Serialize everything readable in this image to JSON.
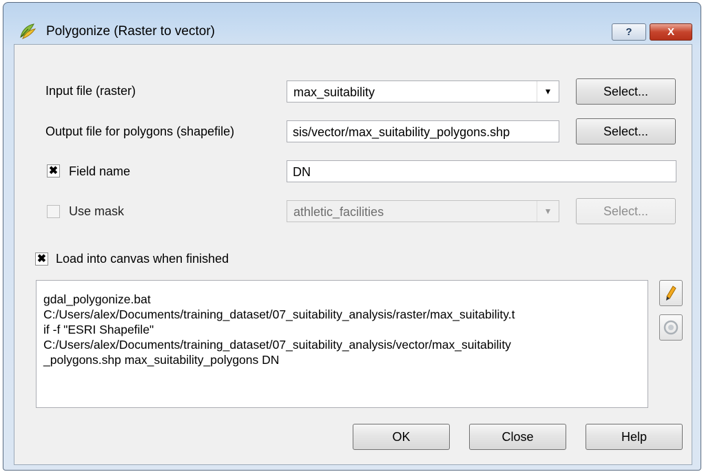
{
  "window": {
    "title": "Polygonize (Raster to vector)",
    "help_label": "?",
    "close_label": "X"
  },
  "form": {
    "input_label": "Input file (raster)",
    "input_value": "max_suitability",
    "input_select": "Select...",
    "output_label": "Output file for polygons (shapefile)",
    "output_value": "sis/vector/max_suitability_polygons.shp",
    "output_select": "Select...",
    "field_checked": true,
    "field_label": "Field name",
    "field_value": "DN",
    "mask_checked": false,
    "mask_label": "Use mask",
    "mask_value": "athletic_facilities",
    "mask_select": "Select...",
    "load_checked": true,
    "load_label": "Load into canvas when finished"
  },
  "command": {
    "lines": [
      "gdal_polygonize.bat",
      "C:/Users/alex/Documents/training_dataset/07_suitability_analysis/raster/max_suitability.t",
      "if -f \"ESRI Shapefile\"",
      "C:/Users/alex/Documents/training_dataset/07_suitability_analysis/vector/max_suitability",
      "_polygons.shp max_suitability_polygons DN"
    ]
  },
  "buttons": {
    "ok": "OK",
    "close": "Close",
    "help": "Help"
  },
  "icons": {
    "app": "qgis-leaf-icon",
    "edit": "pencil-icon",
    "reset": "reset-icon"
  }
}
